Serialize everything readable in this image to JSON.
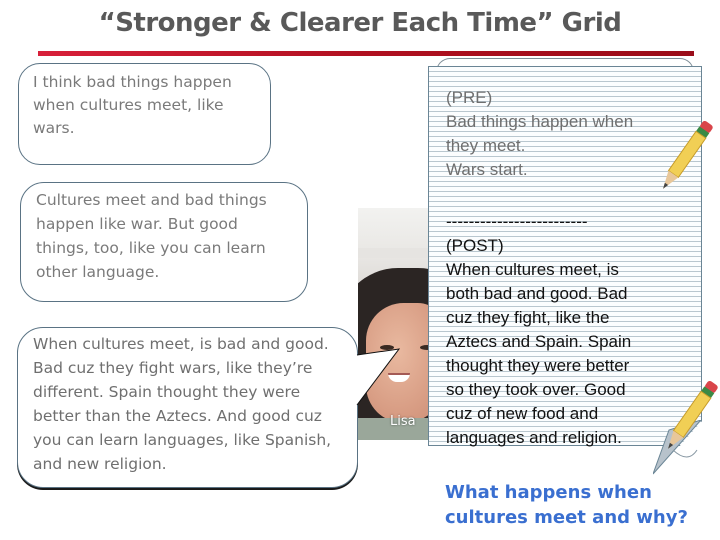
{
  "title": "“Stronger & Clearer Each Time” Grid",
  "colors": {
    "title_rule": "#c0142a",
    "question": "#3a6fd0",
    "bubble_border": "#5a7384"
  },
  "bubbles": [
    {
      "text": "I think bad things happen when cultures meet, like wars."
    },
    {
      "text": "Cultures meet and bad things happen like war. But good things, too, like you can learn other language."
    },
    {
      "text": "When cultures meet, is bad and good. Bad cuz they fight wars, like they’re different. Spain thought they were better than the Aztecs. And good cuz you can learn languages, like Spanish, and new religion."
    }
  ],
  "student": {
    "name": "Lisa"
  },
  "notepad": {
    "pre_label": "(PRE)",
    "pre_lines": [
      "Bad things happen when",
      "they meet.",
      "Wars start."
    ],
    "separator": "-------------------------",
    "post_label": "(POST)",
    "post_lines": [
      "When cultures meet, is",
      "both bad and good. Bad",
      "cuz they fight, like the",
      "Aztecs and Spain. Spain",
      "thought they were better",
      "so they took over. Good",
      "cuz of new food and",
      "languages and religion."
    ]
  },
  "question": {
    "line1": "What happens when",
    "line2": "cultures meet and why?"
  },
  "icons": [
    "pencil-icon",
    "pencil-icon",
    "page-curl-icon",
    "speech-bubble-tail"
  ]
}
